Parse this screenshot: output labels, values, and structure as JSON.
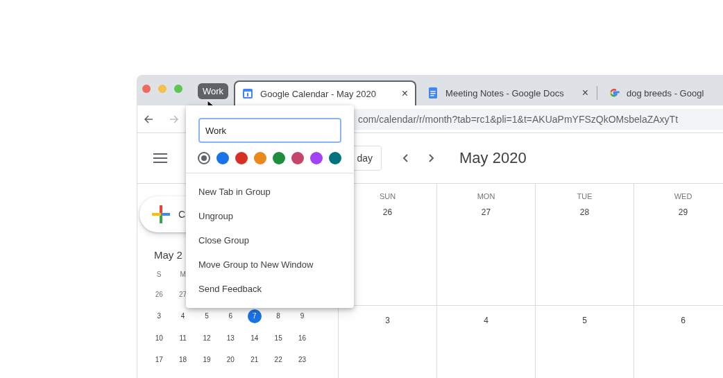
{
  "tab_group": {
    "label": "Work"
  },
  "tabs": [
    {
      "kind": "calendar",
      "title": "Google Calendar - May 2020",
      "close": "×",
      "selected": true
    },
    {
      "kind": "docs",
      "title": "Meeting Notes - Google Docs",
      "close": "×",
      "selected": false
    },
    {
      "kind": "google",
      "title": "dog breeds - Googl",
      "selected": false
    }
  ],
  "toolbar": {
    "url": "com/calendar/r/month?tab=rc1&pli=1&t=AKUaPmYFSzQkOMsbelaZAxyTt"
  },
  "group_menu": {
    "name_value": "Work",
    "colors": [
      {
        "color": "#5f6368",
        "selected": true
      },
      {
        "color": "#1a73e8",
        "selected": false
      },
      {
        "color": "#d93025",
        "selected": false
      },
      {
        "color": "#e8891a",
        "selected": false
      },
      {
        "color": "#1e8e3e",
        "selected": false
      },
      {
        "color": "#c4466a",
        "selected": false
      },
      {
        "color": "#a142f4",
        "selected": false
      },
      {
        "color": "#00737c",
        "selected": false
      }
    ],
    "items": [
      "New Tab in Group",
      "Ungroup",
      "Close Group",
      "Move Group to New Window",
      "Send Feedback"
    ]
  },
  "calendar": {
    "today_button": "day",
    "title": "May 2020",
    "create_label": "C",
    "mini": {
      "title": "May 2",
      "weekdays": [
        "S",
        "M"
      ],
      "weeks": [
        [
          {
            "day": "26",
            "outside": true,
            "selected": false
          },
          {
            "day": "27",
            "outside": true,
            "selected": false
          }
        ],
        [
          {
            "day": "3",
            "outside": false,
            "selected": false
          },
          {
            "day": "4",
            "outside": false,
            "selected": false
          },
          {
            "day": "5",
            "outside": false,
            "selected": false
          },
          {
            "day": "6",
            "outside": false,
            "selected": false
          },
          {
            "day": "7",
            "outside": false,
            "selected": true
          },
          {
            "day": "8",
            "outside": false,
            "selected": false
          },
          {
            "day": "9",
            "outside": false,
            "selected": false
          }
        ],
        [
          {
            "day": "10",
            "outside": false,
            "selected": false
          },
          {
            "day": "11",
            "outside": false,
            "selected": false
          },
          {
            "day": "12",
            "outside": false,
            "selected": false
          },
          {
            "day": "13",
            "outside": false,
            "selected": false
          },
          {
            "day": "14",
            "outside": false,
            "selected": false
          },
          {
            "day": "15",
            "outside": false,
            "selected": false
          },
          {
            "day": "16",
            "outside": false,
            "selected": false
          }
        ],
        [
          {
            "day": "17",
            "outside": false,
            "selected": false
          },
          {
            "day": "18",
            "outside": false,
            "selected": false
          },
          {
            "day": "19",
            "outside": false,
            "selected": false
          },
          {
            "day": "20",
            "outside": false,
            "selected": false
          },
          {
            "day": "21",
            "outside": false,
            "selected": false
          },
          {
            "day": "22",
            "outside": false,
            "selected": false
          },
          {
            "day": "23",
            "outside": false,
            "selected": false
          }
        ]
      ]
    },
    "grid": {
      "columns": [
        {
          "weekday": "SUN",
          "day": "26"
        },
        {
          "weekday": "MON",
          "day": "27"
        },
        {
          "weekday": "TUE",
          "day": "28"
        },
        {
          "weekday": "WED",
          "day": "29"
        }
      ],
      "week_2": [
        "3",
        "4",
        "5",
        "6"
      ]
    }
  }
}
